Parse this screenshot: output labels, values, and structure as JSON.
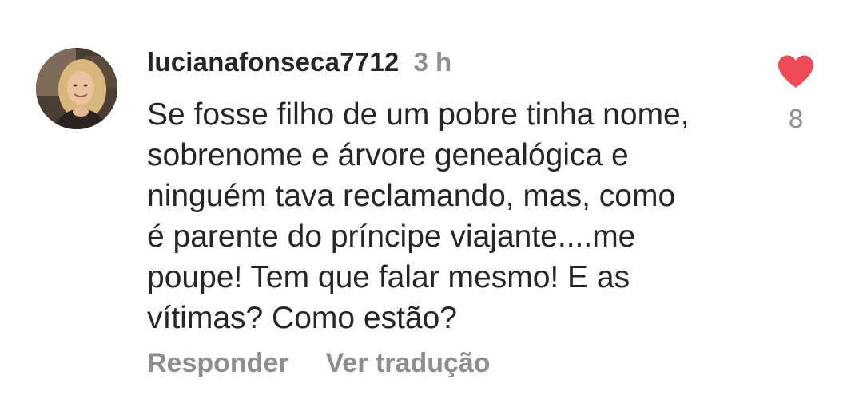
{
  "comment": {
    "username": "lucianafonseca7712",
    "timestamp": "3 h",
    "text": "Se fosse filho de um pobre tinha nome,\nsobrenome e árvore genealógica e\nninguém tava reclamando, mas, como\né parente do príncipe viajante....me\npoupe! Tem que falar mesmo! E as\nvítimas? Como estão?",
    "like_count": "8",
    "liked": true,
    "actions": {
      "reply_label": "Responder",
      "translate_label": "Ver tradução"
    }
  },
  "colors": {
    "primary_text": "#262626",
    "secondary_text": "#8e8e8e",
    "heart": "#ed4956"
  },
  "icons": {
    "like": "heart-filled-icon"
  }
}
